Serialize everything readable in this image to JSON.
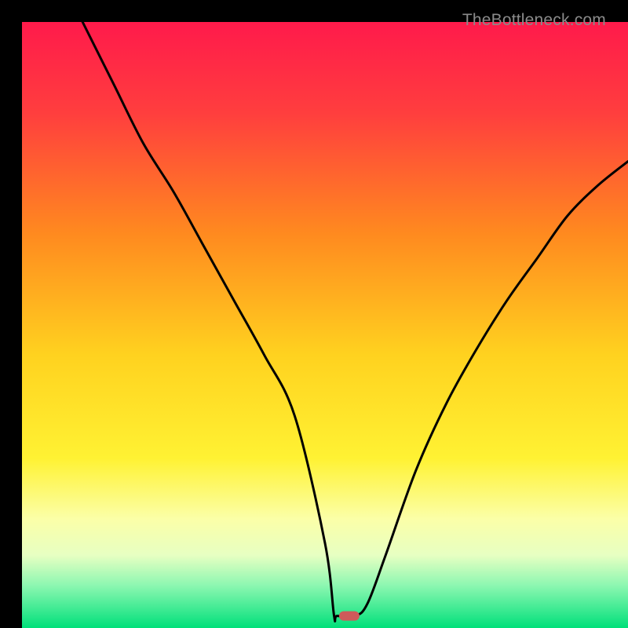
{
  "watermark": "TheBottleneck.com",
  "chart_data": {
    "type": "line",
    "title": "",
    "xlabel": "",
    "ylabel": "",
    "xlim": [
      0,
      100
    ],
    "ylim": [
      0,
      100
    ],
    "legend": false,
    "background": "rainbow-gradient",
    "series": [
      {
        "name": "bottleneck-curve",
        "x": [
          10,
          15,
          20,
          25,
          30,
          35,
          40,
          45,
          50,
          51.5,
          52,
          55,
          57,
          60,
          65,
          70,
          75,
          80,
          85,
          90,
          95,
          100
        ],
        "values": [
          100,
          90,
          80,
          72,
          63,
          54,
          45,
          35,
          14,
          2,
          2,
          2,
          4,
          12,
          26,
          37,
          46,
          54,
          61,
          68,
          73,
          77
        ]
      }
    ],
    "marker": {
      "x": 54,
      "y": 2,
      "color": "#ce5a5a",
      "shape": "pill"
    },
    "gradient_stops": [
      {
        "pct": 0,
        "color": "#ff1a4b"
      },
      {
        "pct": 15,
        "color": "#ff3e3e"
      },
      {
        "pct": 35,
        "color": "#ff8a1f"
      },
      {
        "pct": 55,
        "color": "#ffd21f"
      },
      {
        "pct": 72,
        "color": "#fff233"
      },
      {
        "pct": 82,
        "color": "#fbffa8"
      },
      {
        "pct": 88,
        "color": "#e7ffc2"
      },
      {
        "pct": 93,
        "color": "#8cf7b1"
      },
      {
        "pct": 100,
        "color": "#00e07a"
      }
    ]
  }
}
